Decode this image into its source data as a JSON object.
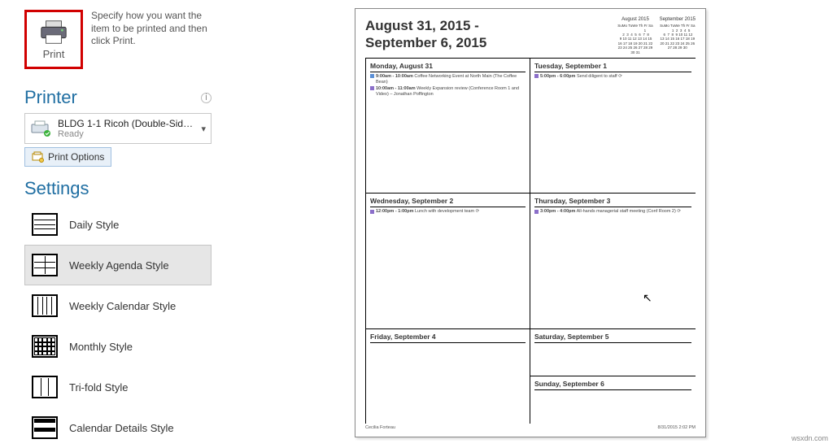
{
  "print": {
    "button_label": "Print",
    "description": "Specify how you want the item to be printed and then click Print."
  },
  "printer": {
    "section_title": "Printer",
    "name": "BLDG 1-1 Ricoh (Double-Sid…",
    "status": "Ready",
    "options_label": "Print Options"
  },
  "settings": {
    "section_title": "Settings",
    "styles": [
      {
        "label": "Daily Style",
        "selected": false
      },
      {
        "label": "Weekly Agenda Style",
        "selected": true
      },
      {
        "label": "Weekly Calendar Style",
        "selected": false
      },
      {
        "label": "Monthly Style",
        "selected": false
      },
      {
        "label": "Tri-fold Style",
        "selected": false
      },
      {
        "label": "Calendar Details Style",
        "selected": false
      }
    ]
  },
  "preview": {
    "title_line1": "August 31, 2015 -",
    "title_line2": "September 6, 2015",
    "minical1_title": "August 2015",
    "minical1_body": "SuMo TuWe Th Fr Sa\n                   1\n 2  3  4  5  6  7  8\n 9 10 11 12 13 14 15\n16 17 18 19 20 21 22\n23 24 25 26 27 28 29\n30 31",
    "minical2_title": "September 2015",
    "minical2_body": "SuMo TuWe Th Fr Sa\n       1  2  3  4  5\n 6  7  8  9 10 11 12\n13 14 15 16 17 18 19\n20 21 22 23 24 25 26\n27 28 29 30",
    "days": {
      "mon": {
        "title": "Monday, August 31",
        "events": [
          {
            "time": "9:00am - 10:00am",
            "text": "Coffee Networking Event at North Main (The Coffee Bean)",
            "color": "blue"
          },
          {
            "time": "10:00am - 11:00am",
            "text": "Weekly Expansion review (Conference Room 1 and Video) – Jonathan Poffington",
            "color": "purple"
          }
        ]
      },
      "tue": {
        "title": "Tuesday, September 1",
        "events": [
          {
            "time": "5:00pm - 6:00pm",
            "text": "Send diligent to staff ⟳",
            "color": "purple"
          }
        ]
      },
      "wed": {
        "title": "Wednesday, September 2",
        "events": [
          {
            "time": "12:00pm - 1:00pm",
            "text": "Lunch with development team ⟳",
            "color": "purple"
          }
        ]
      },
      "thu": {
        "title": "Thursday, September 3",
        "events": [
          {
            "time": "3:00pm - 4:00pm",
            "text": "All-hands managerial staff meeting (Conf Room 2) ⟳",
            "color": "purple"
          }
        ]
      },
      "fri": {
        "title": "Friday, September 4"
      },
      "sat": {
        "title": "Saturday, September 5"
      },
      "sun": {
        "title": "Sunday, September 6"
      }
    },
    "footer_left": "Cecilia Forteau",
    "footer_right": "8/31/2015 2:02 PM"
  },
  "watermark": "wsxdn.com"
}
